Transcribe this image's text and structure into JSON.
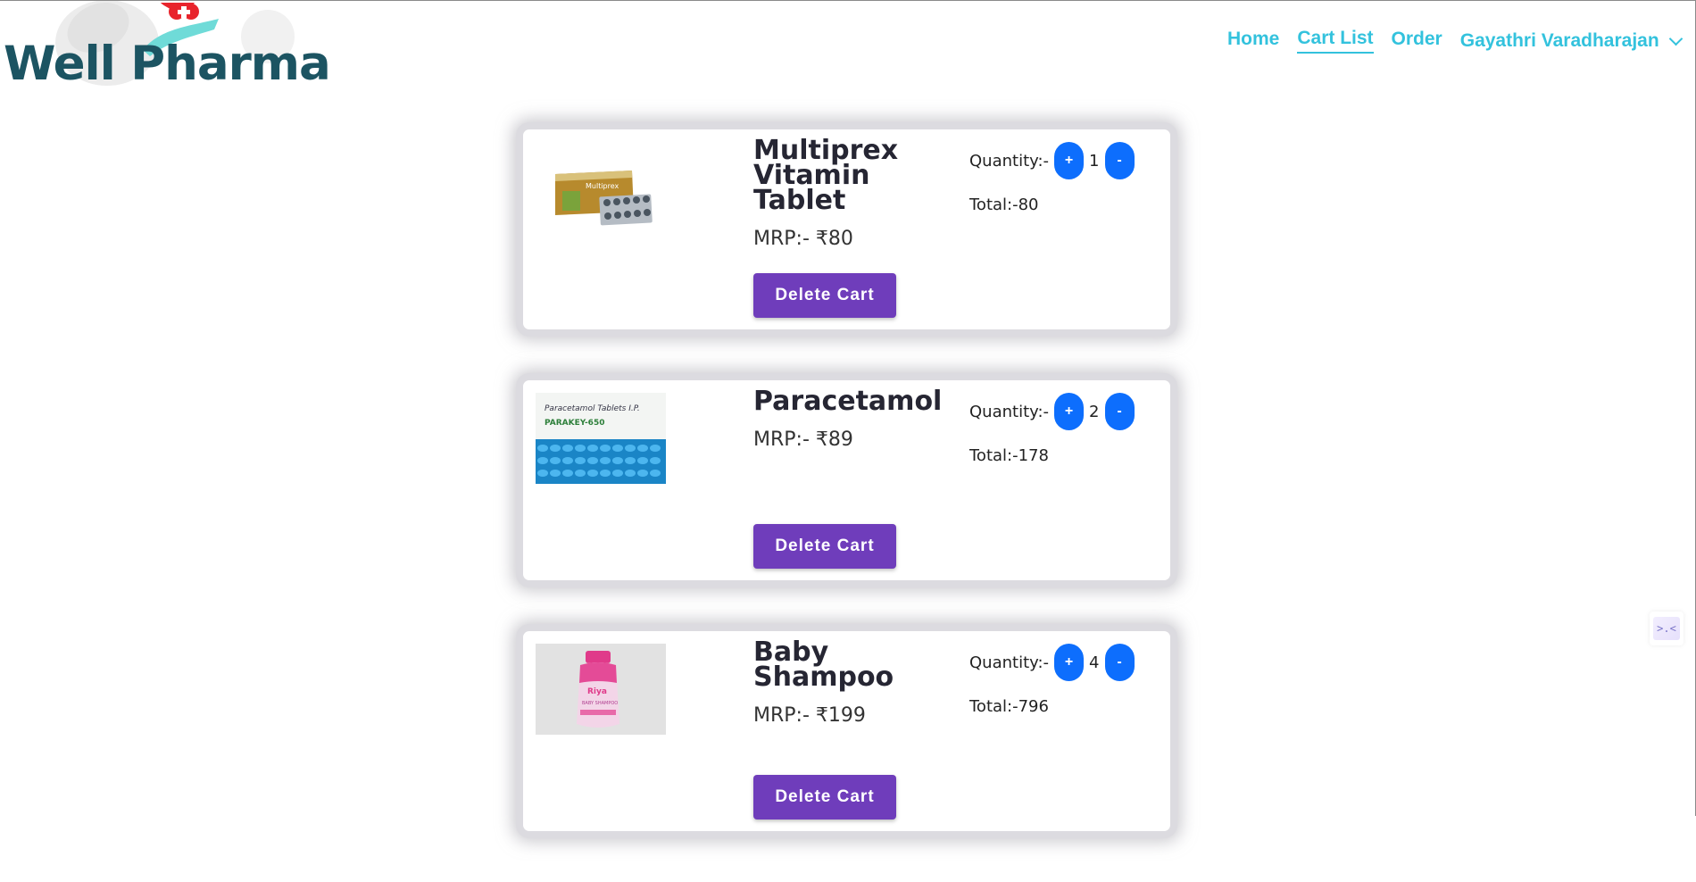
{
  "header": {
    "brand": "Well Pharma",
    "nav": {
      "home": "Home",
      "cart_list": "Cart List",
      "order": "Order",
      "user": "Gayathri Varadharajan"
    }
  },
  "cart": {
    "items": [
      {
        "name": "Multiprex Vitamin Tablet",
        "mrp": "MRP:- ₹80",
        "quantity_label": "Quantity:-",
        "quantity": "1",
        "total": "Total:-80",
        "delete_label": "Delete Cart",
        "plus": "+",
        "minus": "-",
        "box_text": "Multiprex"
      },
      {
        "name": "Paracetamol",
        "mrp": "MRP:- ₹89",
        "quantity_label": "Quantity:-",
        "quantity": "2",
        "total": "Total:-178",
        "delete_label": "Delete Cart",
        "plus": "+",
        "minus": "-",
        "box_text": "Paracetamol Tablets I.P.",
        "box_text_2": "PARAKEY-650"
      },
      {
        "name": "Baby Shampoo",
        "mrp": "MRP:- ₹199",
        "quantity_label": "Quantity:-",
        "quantity": "4",
        "total": "Total:-796",
        "delete_label": "Delete Cart",
        "plus": "+",
        "minus": "-",
        "box_text": "Riya",
        "box_text_2": "BABY SHAMPOO"
      }
    ]
  },
  "widget": {
    "glyph": ">.<"
  },
  "colors": {
    "nav": "#33c2dd",
    "brand": "#1c5462",
    "delete_button": "#6f3dbb",
    "quantity_button": "#0d6efd"
  }
}
